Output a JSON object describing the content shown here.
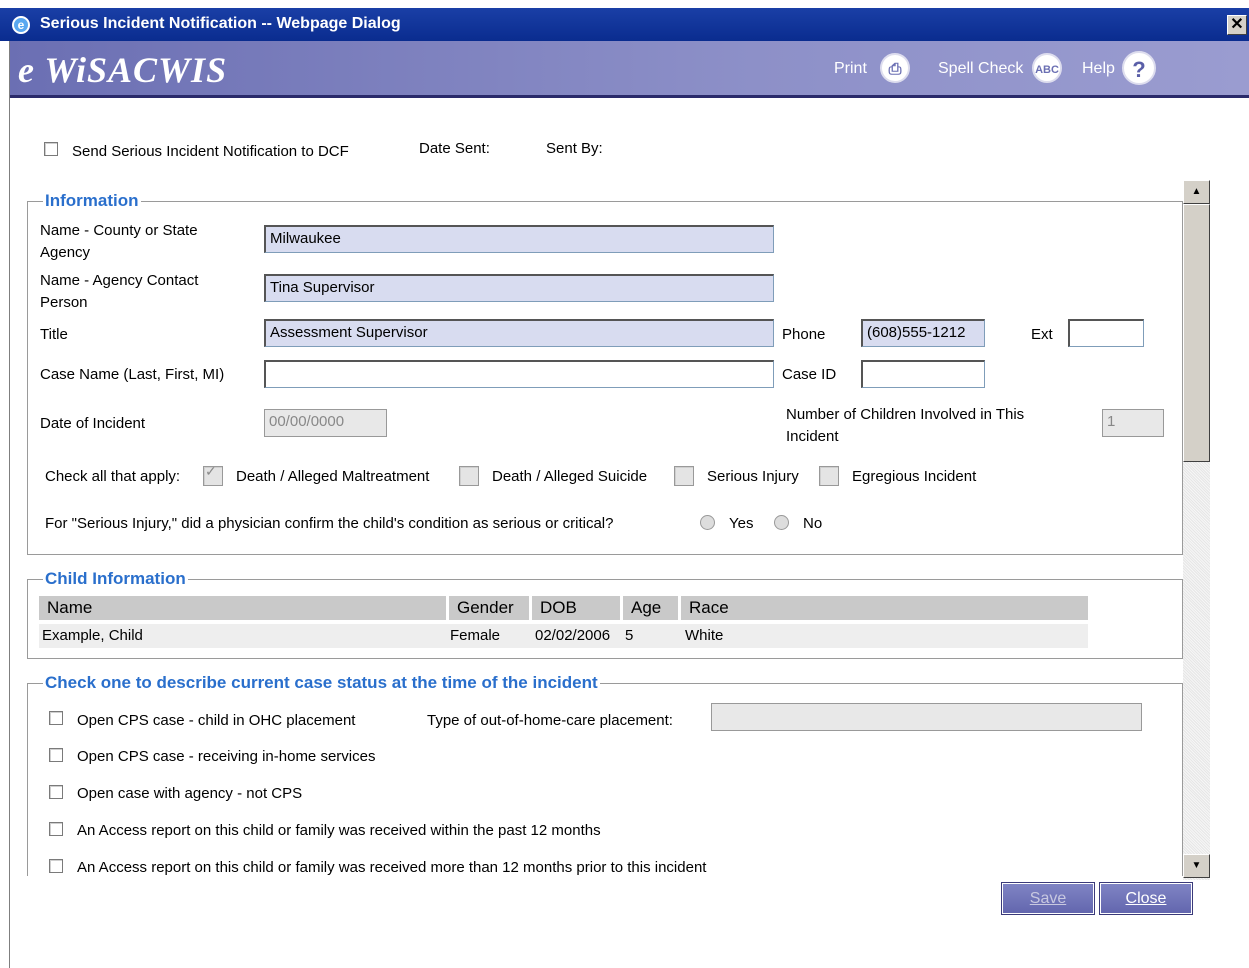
{
  "window": {
    "title": "Serious Incident Notification -- Webpage Dialog",
    "close": "✕"
  },
  "header": {
    "logo": "e WiSACWIS",
    "print": "Print",
    "spell_check": "Spell Check",
    "help": "Help"
  },
  "notify": {
    "label": "Send Serious Incident Notification to DCF",
    "date_sent": "Date Sent:",
    "sent_by": "Sent By:"
  },
  "information": {
    "legend": "Information",
    "agency_label": "Name - County or State Agency",
    "agency_value": "Milwaukee",
    "contact_label": "Name - Agency Contact Person",
    "contact_value": "Tina Supervisor",
    "title_label": "Title",
    "title_value": "Assessment Supervisor",
    "phone_label": "Phone",
    "phone_value": "(608)555-1212",
    "ext_label": "Ext",
    "ext_value": "",
    "case_name_label": "Case Name (Last, First, MI)",
    "case_name_value": "",
    "case_id_label": "Case ID",
    "case_id_value": "",
    "date_label": "Date of Incident",
    "date_value": "00/00/0000",
    "num_children_label": "Number of Children Involved in This Incident",
    "num_children_value": "1",
    "check_all_label": "Check all that apply:",
    "opt_death_maltreatment": "Death / Alleged Maltreatment",
    "opt_death_suicide": "Death / Alleged Suicide",
    "opt_serious_injury": "Serious Injury",
    "opt_egregious": "Egregious Incident",
    "physician_question": "For \"Serious Injury,\" did a physician confirm the child's condition as serious or critical?",
    "yes": "Yes",
    "no": "No"
  },
  "child_info": {
    "legend": "Child Information",
    "headers": {
      "name": "Name",
      "gender": "Gender",
      "dob": "DOB",
      "age": "Age",
      "race": "Race"
    },
    "row": {
      "name": "Example, Child",
      "gender": "Female",
      "dob": "02/02/2006",
      "age": "5",
      "race": "White"
    }
  },
  "case_status": {
    "legend": "Check one to describe current case status at the time of the incident",
    "opt1": "Open CPS case - child in OHC placement",
    "placement_label": "Type of out-of-home-care placement:",
    "placement_value": "",
    "opt2": "Open CPS case - receiving in-home services",
    "opt3": "Open case with agency - not CPS",
    "opt4": "An Access report on this child or family was received within the past 12 months",
    "opt5": "An Access report on this child or family was received more than 12 months prior to this incident"
  },
  "buttons": {
    "save": "Save",
    "close": "Close"
  }
}
